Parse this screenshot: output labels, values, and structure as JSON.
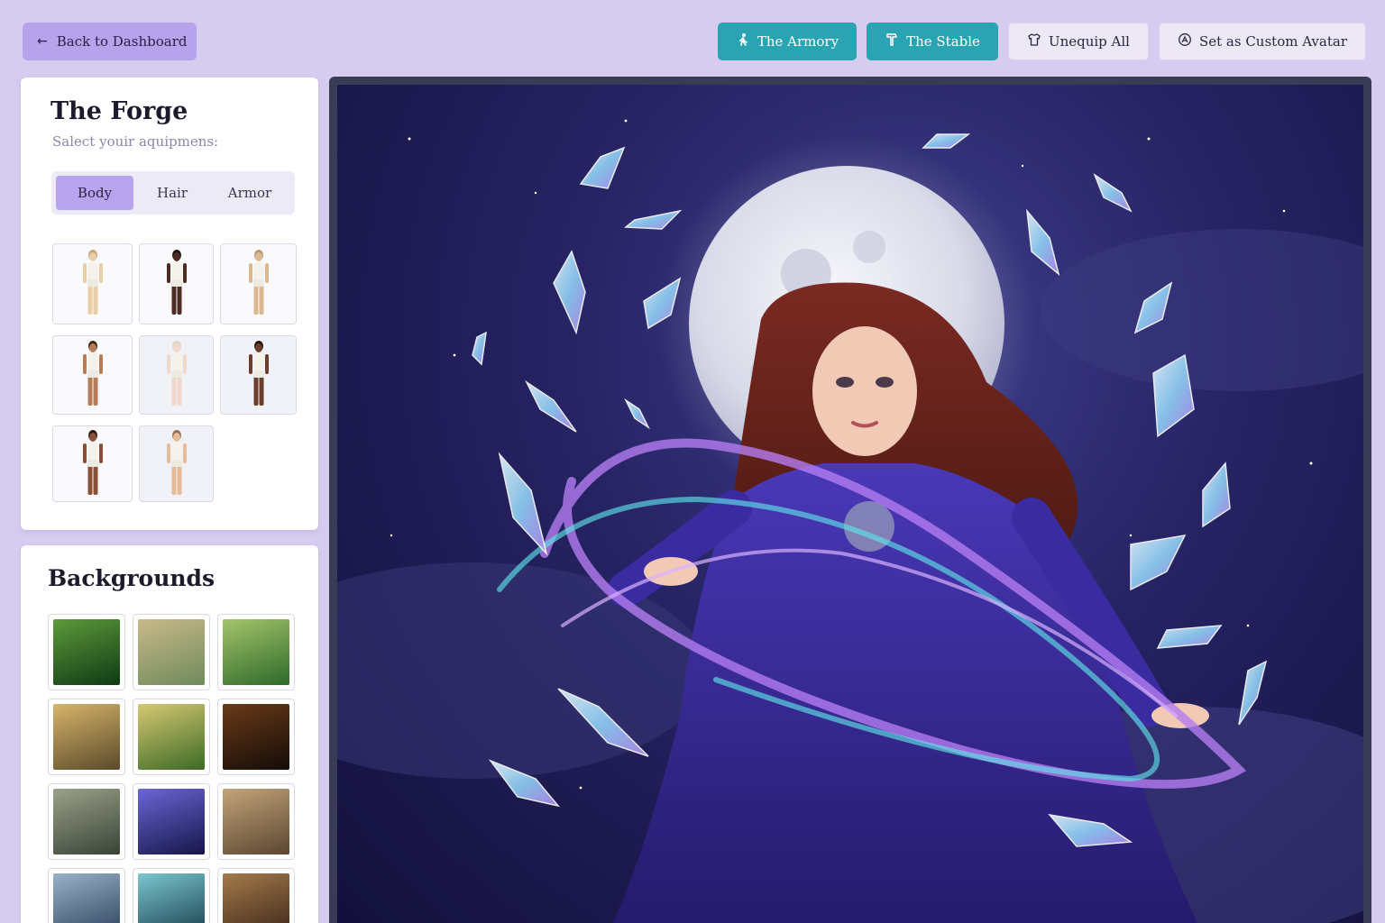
{
  "header": {
    "back_label": "Back to Dashboard",
    "actions": [
      {
        "label": "The Armory",
        "icon": "figure-icon",
        "style": "teal"
      },
      {
        "label": "The Stable",
        "icon": "hammer-icon",
        "style": "teal"
      },
      {
        "label": "Unequip All",
        "icon": "shirt-icon",
        "style": "light"
      },
      {
        "label": "Set as Custom Avatar",
        "icon": "avatar-icon",
        "style": "light"
      }
    ]
  },
  "forge": {
    "title": "The Forge",
    "subtitle": "Salect youir aquipmens:",
    "tabs": [
      {
        "label": "Body",
        "active": true
      },
      {
        "label": "Hair",
        "active": false
      },
      {
        "label": "Armor",
        "active": false
      }
    ],
    "bodies": [
      {
        "skin": "#e8cfa9",
        "hair": "#c9a77a"
      },
      {
        "skin": "#4a2c22",
        "hair": "#1c120e"
      },
      {
        "skin": "#d9b892",
        "hair": "#b99a72"
      },
      {
        "skin": "#b57c57",
        "hair": "#3d2618"
      },
      {
        "skin": "#f1d8cc",
        "hair": "#e6d4c8"
      },
      {
        "skin": "#6a3e2c",
        "hair": "#2a1810"
      },
      {
        "skin": "#8a4f37",
        "hair": "#2c1a12"
      },
      {
        "skin": "#e6bb98",
        "hair": "#9b6f4f"
      }
    ]
  },
  "backgrounds": {
    "title": "Backgrounds",
    "tiles": [
      {
        "name": "forest-glade",
        "colors": [
          "#0f3a15",
          "#5e9a3a"
        ]
      },
      {
        "name": "ruined-path",
        "colors": [
          "#6f8a5a",
          "#c9b98a"
        ]
      },
      {
        "name": "sunny-forest",
        "colors": [
          "#2e6a2a",
          "#a4c46a"
        ]
      },
      {
        "name": "village-hills",
        "colors": [
          "#5a4a2a",
          "#d8b46a"
        ]
      },
      {
        "name": "meadow",
        "colors": [
          "#3c6a25",
          "#d6c872"
        ]
      },
      {
        "name": "dark-tavern",
        "colors": [
          "#140c08",
          "#6a3a18"
        ]
      },
      {
        "name": "misty-field",
        "colors": [
          "#3a4236",
          "#9aa28a"
        ]
      },
      {
        "name": "crystal-cave",
        "colors": [
          "#16164a",
          "#6a66d6"
        ]
      },
      {
        "name": "old-town",
        "colors": [
          "#5a4630",
          "#c4a47a"
        ]
      },
      {
        "name": "castle-tower",
        "colors": [
          "#2a3e5a",
          "#9ab2c8"
        ]
      },
      {
        "name": "ice-hall",
        "colors": [
          "#163a48",
          "#7ac6d0"
        ]
      },
      {
        "name": "armory-hall",
        "colors": [
          "#3a2418",
          "#a47a4a"
        ]
      }
    ]
  },
  "colors": {
    "page_bg": "#d6ccf0",
    "teal": "#2aa4b3",
    "accent_purple": "#b8a3ef"
  }
}
